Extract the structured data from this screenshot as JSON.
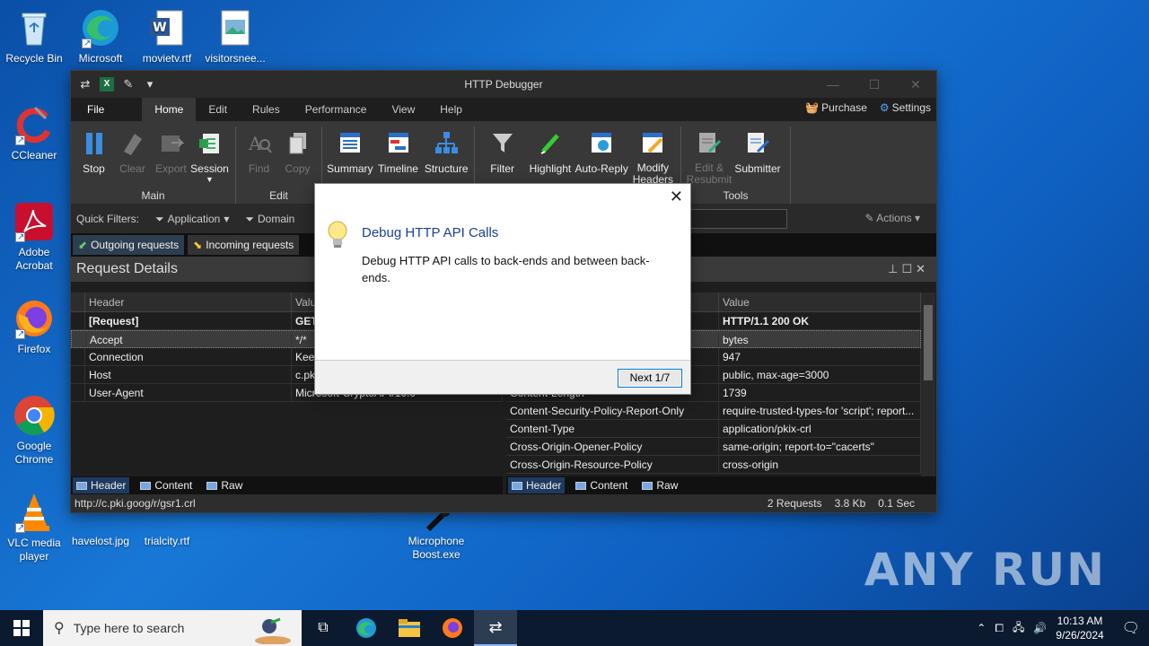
{
  "desktop": {
    "icons": [
      {
        "label": "Recycle Bin"
      },
      {
        "label": "Microsoft Edge"
      },
      {
        "label": "movietv.rtf"
      },
      {
        "label": "visitorsnee..."
      },
      {
        "label": "CCleaner"
      },
      {
        "label": "Adobe Acrobat"
      },
      {
        "label": "Firefox"
      },
      {
        "label": "Google Chrome"
      },
      {
        "label": "VLC media player"
      },
      {
        "label": "havelost.jpg"
      },
      {
        "label": "trialcity.rtf"
      },
      {
        "label": "Microphone Boost.exe"
      }
    ]
  },
  "window": {
    "title": "HTTP Debugger",
    "menu": {
      "file": "File",
      "home": "Home",
      "edit": "Edit",
      "rules": "Rules",
      "performance": "Performance",
      "view": "View",
      "help": "Help",
      "purchase": "Purchase",
      "settings": "Settings"
    },
    "ribbon": {
      "main": {
        "name": "Main",
        "stop": "Stop",
        "clear": "Clear",
        "export": "Export",
        "session": "Session"
      },
      "edit": {
        "name": "Edit",
        "find": "Find",
        "copy": "Copy"
      },
      "view": {
        "summary": "Summary",
        "timeline": "Timeline",
        "structure": "Structure"
      },
      "rules": {
        "filter": "Filter",
        "highlight": "Highlight",
        "auto_reply": "Auto-Reply",
        "modify_headers": "Modify Headers"
      },
      "tools": {
        "name": "Tools",
        "edit_resubmit": "Edit & Resubmit",
        "submitter": "Submitter"
      }
    },
    "quick_filters": {
      "label": "Quick Filters:",
      "application": "Application",
      "domain": "Domain",
      "actions": "Actions"
    },
    "tabs": {
      "outgoing": "Outgoing requests",
      "incoming": "Incoming requests"
    },
    "panel_title": "Request Details",
    "request_grid": {
      "columns": [
        "Header",
        "Value"
      ],
      "rows": [
        [
          "[Request]",
          "GET"
        ],
        [
          "Accept",
          "*/*"
        ],
        [
          "Connection",
          "Keep"
        ],
        [
          "Host",
          "c.pki"
        ],
        [
          "User-Agent",
          "Microsoft-CryptoAPI/10.0"
        ]
      ]
    },
    "response_grid": {
      "columns": [
        "",
        "Value"
      ],
      "rows": [
        [
          "",
          "HTTP/1.1 200 OK"
        ],
        [
          "",
          "bytes"
        ],
        [
          "",
          "947"
        ],
        [
          "",
          "public, max-age=3000"
        ],
        [
          "Content-Length",
          "1739"
        ],
        [
          "Content-Security-Policy-Report-Only",
          "require-trusted-types-for 'script'; report..."
        ],
        [
          "Content-Type",
          "application/pkix-crl"
        ],
        [
          "Cross-Origin-Opener-Policy",
          "same-origin; report-to=\"cacerts\""
        ],
        [
          "Cross-Origin-Resource-Policy",
          "cross-origin"
        ]
      ]
    },
    "bottom_tabs": {
      "header": "Header",
      "content": "Content",
      "raw": "Raw"
    },
    "status": {
      "url": "http://c.pki.goog/r/gsr1.crl",
      "requests": "2 Requests",
      "size": "3.8 Kb",
      "time": "0.1 Sec"
    }
  },
  "dialog": {
    "title": "Debug HTTP API Calls",
    "body": "Debug HTTP API calls to back-ends and between back-ends.",
    "next": "Next 1/7"
  },
  "taskbar": {
    "search_placeholder": "Type here to search",
    "time": "10:13 AM",
    "date": "9/26/2024"
  },
  "watermark": "ANY RUN"
}
